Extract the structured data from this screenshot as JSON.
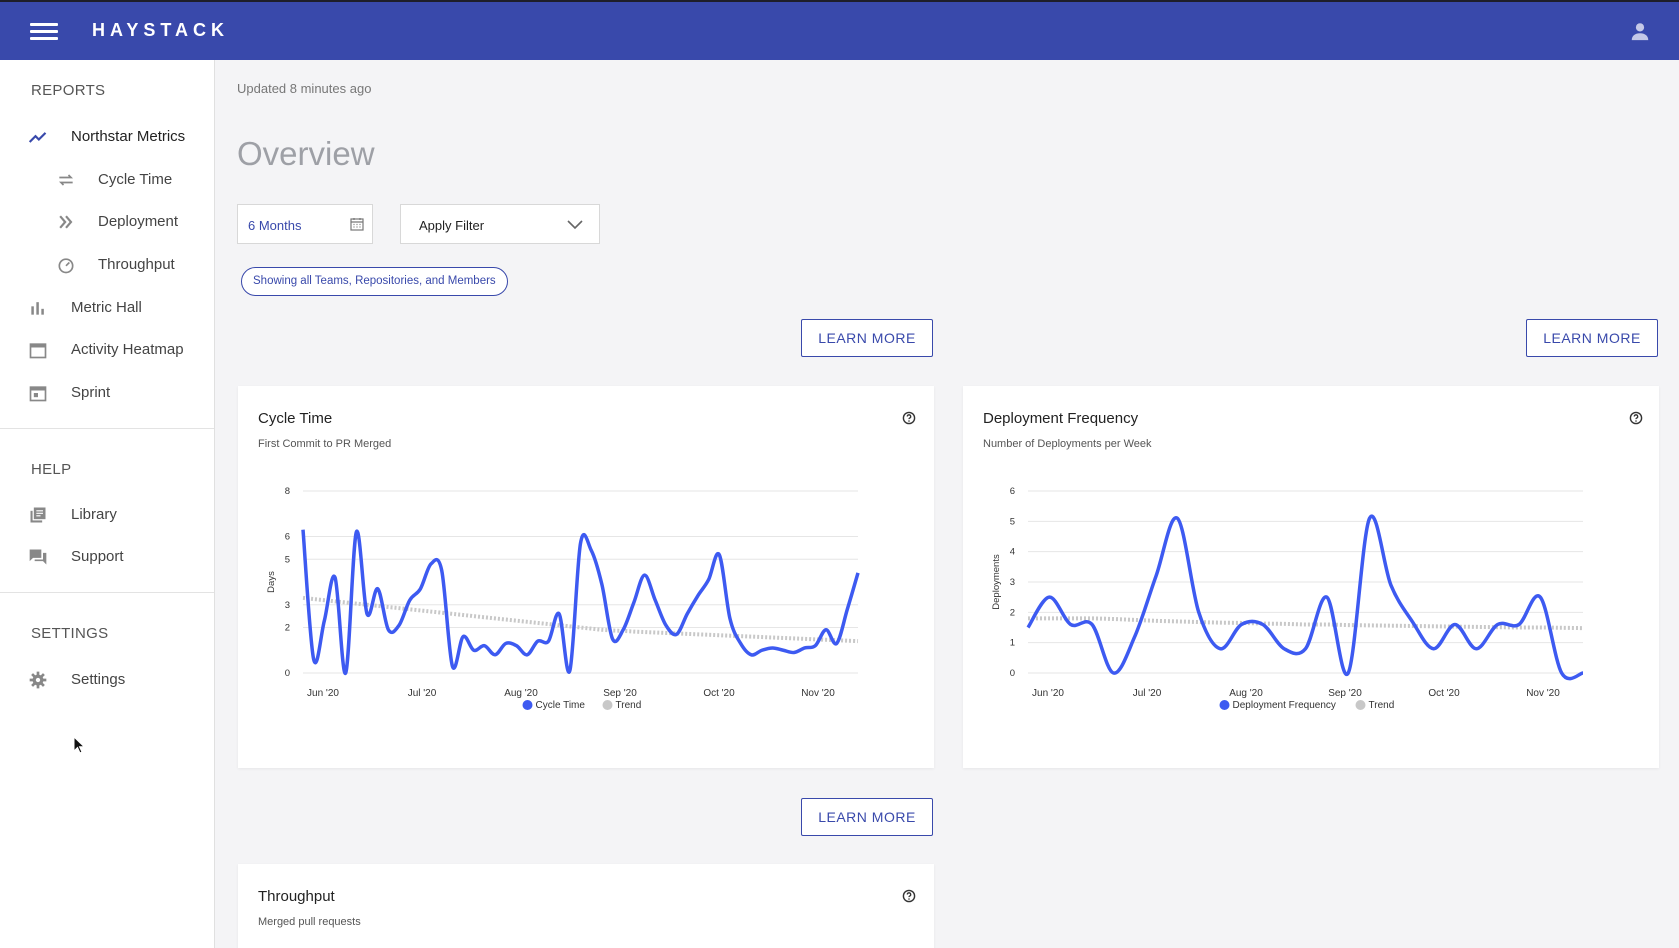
{
  "header": {
    "brand": "HAYSTACK",
    "menu_icon": "hamburger-menu-icon",
    "user_icon": "user-account-icon",
    "bar_color": "#3949ab"
  },
  "sidebar": {
    "reports_title": "REPORTS",
    "help_title": "HELP",
    "settings_title": "SETTINGS",
    "items": [
      {
        "label": "Northstar Metrics",
        "icon": "trending-up-icon",
        "active": true
      },
      {
        "label": "Cycle Time",
        "icon": "repeat-icon"
      },
      {
        "label": "Deployment",
        "icon": "double-chevron-right-icon"
      },
      {
        "label": "Throughput",
        "icon": "speedometer-icon"
      },
      {
        "label": "Metric Hall",
        "icon": "bar-chart-icon"
      },
      {
        "label": "Activity Heatmap",
        "icon": "calendar-icon"
      },
      {
        "label": "Sprint",
        "icon": "calendar-event-icon"
      },
      {
        "label": "Library",
        "icon": "library-books-icon"
      },
      {
        "label": "Support",
        "icon": "chat-bubbles-icon"
      },
      {
        "label": "Settings",
        "icon": "gear-icon"
      }
    ]
  },
  "main": {
    "updated": "Updated 8 minutes ago",
    "title": "Overview",
    "date_range": "6 Months",
    "filter_label": "Apply Filter",
    "scope_chip": "Showing all Teams, Repositories, and Members",
    "learn_more": "LEARN MORE",
    "accent": "#3949ab"
  },
  "cards": {
    "cycle": {
      "title": "Cycle Time",
      "subtitle": "First Commit to PR Merged"
    },
    "deploy": {
      "title": "Deployment Frequency",
      "subtitle": "Number of Deployments per Week"
    },
    "throughput": {
      "title": "Throughput",
      "subtitle": "Merged pull requests"
    }
  },
  "chart_data": [
    {
      "type": "line",
      "title": "Cycle Time",
      "subtitle": "First Commit to PR Merged",
      "ylabel": "Days",
      "y_ticks": [
        0,
        2,
        3,
        5,
        6,
        8
      ],
      "ylim": [
        0,
        8
      ],
      "x_ticks": [
        "Jun '20",
        "Jul '20",
        "Aug '20",
        "Sep '20",
        "Oct '20",
        "Nov '20"
      ],
      "grid": true,
      "legend_position": "bottom",
      "x": [
        0,
        0.5,
        1,
        1.5,
        2,
        2.5,
        3,
        3.5,
        4,
        4.5,
        5,
        5.5,
        6,
        6.5,
        7,
        7.5,
        8,
        8.5,
        9,
        9.5,
        10,
        10.5,
        11,
        11.5,
        12,
        12.5,
        13,
        13.5,
        14,
        14.5,
        15,
        15.5,
        16,
        16.5,
        17,
        17.5,
        18,
        18.5,
        19,
        19.5,
        20,
        20.5,
        21,
        21.5,
        22,
        22.5,
        23,
        23.5,
        24,
        24.5,
        25,
        25.5,
        26
      ],
      "series": [
        {
          "name": "Cycle Time",
          "color": "#3d5af1",
          "values": [
            6.3,
            0.6,
            2.3,
            4.2,
            0,
            6.2,
            2.6,
            3.7,
            1.9,
            2.1,
            3.2,
            3.7,
            4.8,
            4.5,
            0.3,
            1.6,
            1,
            1.2,
            0.8,
            1.3,
            1.2,
            0.8,
            1.4,
            1.4,
            2.6,
            0.1,
            5.7,
            5.4,
            3.9,
            1.5,
            1.9,
            3.1,
            4.3,
            3.2,
            2.1,
            1.7,
            2.6,
            3.4,
            4.1,
            5.2,
            2.4,
            1.3,
            0.8,
            1.0,
            1.1,
            1.0,
            0.9,
            1.1,
            1.2,
            1.9,
            1.3,
            2.8,
            4.4
          ]
        },
        {
          "name": "Trend",
          "color": "#c8c8c8",
          "values": [
            3.3,
            3.25,
            3.2,
            3.15,
            3.1,
            3.05,
            3.0,
            2.95,
            2.9,
            2.85,
            2.8,
            2.75,
            2.7,
            2.65,
            2.6,
            2.55,
            2.5,
            2.45,
            2.4,
            2.35,
            2.3,
            2.25,
            2.2,
            2.15,
            2.1,
            2.05,
            2.0,
            1.95,
            1.9,
            1.87,
            1.85,
            1.82,
            1.8,
            1.78,
            1.76,
            1.74,
            1.72,
            1.7,
            1.68,
            1.66,
            1.64,
            1.62,
            1.6,
            1.58,
            1.56,
            1.54,
            1.52,
            1.5,
            1.48,
            1.46,
            1.44,
            1.42,
            1.4
          ]
        }
      ]
    },
    {
      "type": "line",
      "title": "Deployment Frequency",
      "subtitle": "Number of Deployments per Week",
      "ylabel": "Deployments",
      "y_ticks": [
        0,
        1,
        2,
        3,
        4,
        5,
        6
      ],
      "ylim": [
        0,
        6
      ],
      "x_ticks": [
        "Jun '20",
        "Jul '20",
        "Aug '20",
        "Sep '20",
        "Oct '20",
        "Nov '20"
      ],
      "grid": true,
      "legend_position": "bottom",
      "x": [
        0,
        1,
        2,
        3,
        4,
        5,
        6,
        7,
        8,
        9,
        10,
        11,
        12,
        13,
        14,
        15,
        16,
        17,
        18,
        19,
        20,
        21,
        22,
        23,
        24,
        25,
        26
      ],
      "series": [
        {
          "name": "Deployment Frequency",
          "color": "#3d5af1",
          "values": [
            1.5,
            2.5,
            1.6,
            1.6,
            0,
            1.2,
            3.2,
            5.1,
            2,
            0.8,
            1.6,
            1.6,
            0.8,
            0.8,
            2.5,
            0,
            5.1,
            2.9,
            1.7,
            0.8,
            1.6,
            0.8,
            1.6,
            1.6,
            2.5,
            0,
            0
          ]
        },
        {
          "name": "Trend",
          "color": "#c8c8c8",
          "values": [
            1.8,
            1.8,
            1.8,
            1.8,
            1.78,
            1.75,
            1.72,
            1.7,
            1.68,
            1.66,
            1.65,
            1.63,
            1.62,
            1.6,
            1.6,
            1.58,
            1.57,
            1.56,
            1.55,
            1.54,
            1.53,
            1.52,
            1.51,
            1.5,
            1.5,
            1.49,
            1.48
          ]
        }
      ]
    }
  ]
}
